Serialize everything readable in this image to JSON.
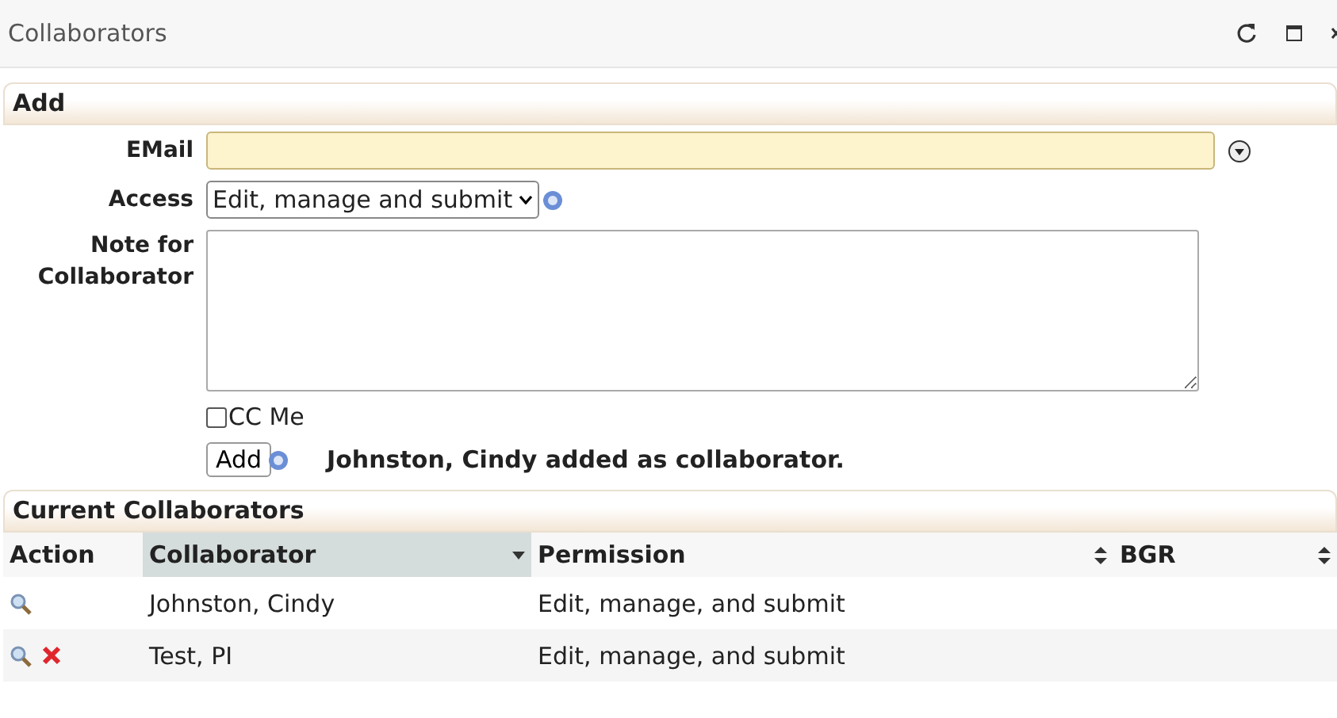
{
  "window": {
    "title": "Collaborators"
  },
  "add_section": {
    "title": "Add",
    "email": {
      "label": "EMail"
    },
    "access": {
      "label": "Access",
      "value": "Edit, manage and submit"
    },
    "note": {
      "label_lines": [
        "Note for",
        "Collaborator"
      ]
    },
    "cc_me": {
      "label": "CC Me",
      "checked": false
    },
    "add_button": "Add",
    "message": "Johnston, Cindy added as collaborator."
  },
  "current_section": {
    "title": "Current Collaborators",
    "columns": [
      {
        "label": "Action",
        "sortable": false,
        "selected": false
      },
      {
        "label": "Collaborator",
        "sortable": true,
        "selected": true
      },
      {
        "label": "Permission",
        "sortable": true,
        "selected": false
      },
      {
        "label": "BGR",
        "sortable": true,
        "selected": false
      }
    ],
    "rows": [
      {
        "removable": false,
        "collaborator": "Johnston, Cindy",
        "permission": "Edit, manage, and submit"
      },
      {
        "removable": true,
        "collaborator": "Test, PI",
        "permission": "Edit, manage, and submit"
      }
    ]
  }
}
